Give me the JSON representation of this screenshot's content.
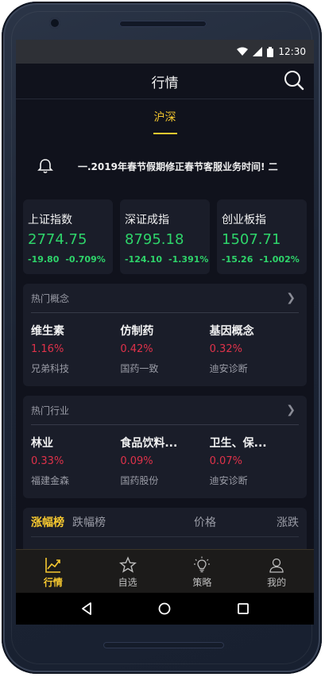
{
  "status": {
    "time": "12:30"
  },
  "header": {
    "title": "行情"
  },
  "tabs": [
    {
      "label": "沪深"
    }
  ],
  "notice": {
    "text": "一.2019年春节假期修正春节客服业务时间! 二"
  },
  "indices": [
    {
      "name": "上证指数",
      "value": "2774.75",
      "change": "-19.80",
      "pct": "-0.709%"
    },
    {
      "name": "深证成指",
      "value": "8795.18",
      "change": "-124.10",
      "pct": "-1.391%"
    },
    {
      "name": "创业板指",
      "value": "1507.71",
      "change": "-15.26",
      "pct": "-1.002%"
    }
  ],
  "hot_concepts": {
    "title": "热门概念",
    "items": [
      {
        "name": "维生素",
        "pct": "1.16%",
        "leader": "兄弟科技"
      },
      {
        "name": "仿制药",
        "pct": "0.42%",
        "leader": "国药一致"
      },
      {
        "name": "基因概念",
        "pct": "0.32%",
        "leader": "迪安诊断"
      }
    ]
  },
  "hot_industries": {
    "title": "热门行业",
    "items": [
      {
        "name": "林业",
        "pct": "0.33%",
        "leader": "福建金森"
      },
      {
        "name": "食品饮料...",
        "pct": "0.09%",
        "leader": "国药股份"
      },
      {
        "name": "卫生、保...",
        "pct": "0.07%",
        "leader": "迪安诊断"
      }
    ]
  },
  "ranking": {
    "tab_up": "涨幅榜",
    "tab_down": "跌幅榜",
    "col_price": "价格",
    "col_change": "涨跌"
  },
  "tabbar": [
    {
      "label": "行情",
      "icon": "chart-line-icon"
    },
    {
      "label": "自选",
      "icon": "star-icon"
    },
    {
      "label": "策略",
      "icon": "lightbulb-icon"
    },
    {
      "label": "我的",
      "icon": "user-icon"
    }
  ],
  "colors": {
    "accent": "#f6c830",
    "down": "#2ed46a",
    "up": "#e0324a",
    "bg": "#10121c",
    "card": "#1a1d29"
  }
}
